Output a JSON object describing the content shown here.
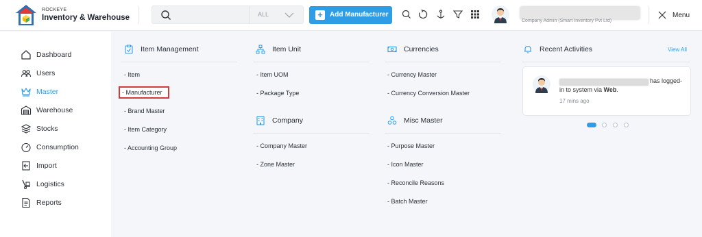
{
  "brand": {
    "small": "ROCKEYE",
    "title": "Inventory & Warehouse"
  },
  "search": {
    "placeholder": "",
    "scope": "ALL"
  },
  "header": {
    "add_button": "Add Manufacturer",
    "user_sub": "Company Admin (Smart Inventory Pvt Ltd)",
    "menu_label": "Menu"
  },
  "colors": {
    "accent": "#2f9de6",
    "highlight_border": "#d33a3a"
  },
  "sidebar": {
    "items": [
      {
        "label": "Dashboard",
        "icon": "home-icon"
      },
      {
        "label": "Users",
        "icon": "users-icon"
      },
      {
        "label": "Master",
        "icon": "crown-icon",
        "active": true
      },
      {
        "label": "Warehouse",
        "icon": "warehouse-icon"
      },
      {
        "label": "Stocks",
        "icon": "layers-icon"
      },
      {
        "label": "Consumption",
        "icon": "gauge-icon"
      },
      {
        "label": "Import",
        "icon": "import-icon"
      },
      {
        "label": "Logistics",
        "icon": "logistics-icon"
      },
      {
        "label": "Reports",
        "icon": "report-icon"
      }
    ]
  },
  "mega": {
    "item_management": {
      "title": "Item Management",
      "links": [
        "- Item",
        "- Manufacturer",
        "- Brand Master",
        "- Item Category",
        "- Accounting Group"
      ]
    },
    "item_unit": {
      "title": "Item Unit",
      "links": [
        "- Item UOM",
        "- Package Type"
      ]
    },
    "company": {
      "title": "Company",
      "links": [
        "- Company Master",
        "- Zone Master"
      ]
    },
    "currencies": {
      "title": "Currencies",
      "links": [
        "- Currency Master",
        "- Currency Conversion Master"
      ]
    },
    "misc": {
      "title": "Misc Master",
      "links": [
        "- Purpose Master",
        "- Icon Master",
        "- Reconcile Reasons",
        "- Batch Master"
      ]
    }
  },
  "activity": {
    "title": "Recent Activities",
    "view_all": "View All",
    "line1": "has logged-",
    "line2_pre": "in to system via ",
    "line2_bold": "Web",
    "line2_post": ".",
    "time": "17 mins ago"
  }
}
